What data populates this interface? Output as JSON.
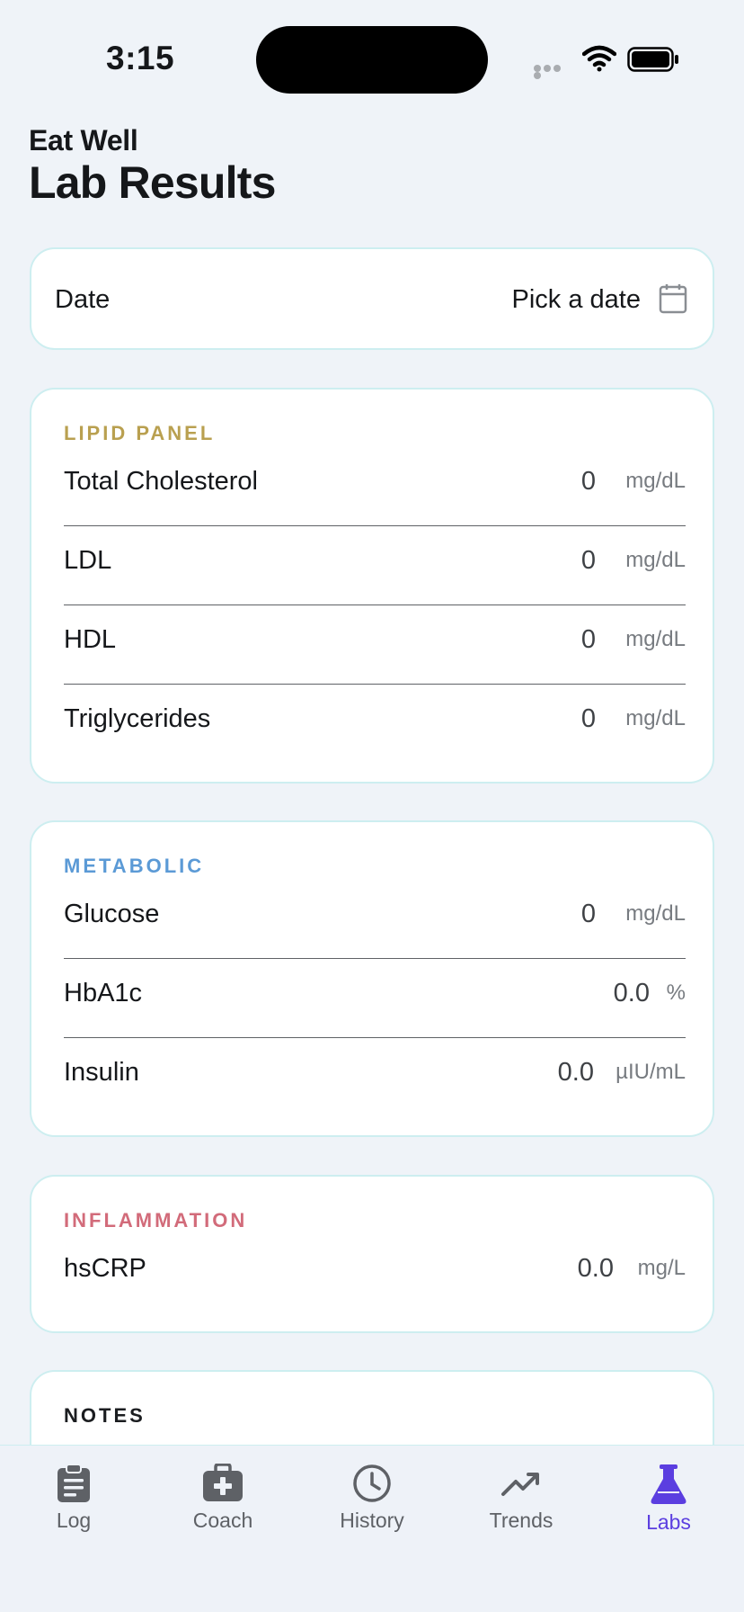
{
  "status_bar": {
    "time": "3:15"
  },
  "header": {
    "app_name": "Eat Well",
    "title": "Lab Results"
  },
  "date_field": {
    "label": "Date",
    "value": "Pick a date"
  },
  "sections": {
    "lipid": {
      "title": "LIPID PANEL",
      "color": "#b9a050",
      "rows": [
        {
          "label": "Total Cholesterol",
          "value": "0",
          "unit": "mg/dL"
        },
        {
          "label": "LDL",
          "value": "0",
          "unit": "mg/dL"
        },
        {
          "label": "HDL",
          "value": "0",
          "unit": "mg/dL"
        },
        {
          "label": "Triglycerides",
          "value": "0",
          "unit": "mg/dL"
        }
      ]
    },
    "metabolic": {
      "title": "METABOLIC",
      "color": "#5b9ad6",
      "rows": [
        {
          "label": "Glucose",
          "value": "0",
          "unit": "mg/dL"
        },
        {
          "label": "HbA1c",
          "value": "0.0",
          "unit": "%"
        },
        {
          "label": "Insulin",
          "value": "0.0",
          "unit": "µIU/mL"
        }
      ]
    },
    "inflammation": {
      "title": "INFLAMMATION",
      "color": "#d26b7a",
      "rows": [
        {
          "label": "hsCRP",
          "value": "0.0",
          "unit": "mg/L"
        }
      ]
    },
    "notes": {
      "title": "NOTES",
      "color": "#1b1d20"
    }
  },
  "tab_bar": {
    "active_color": "#5b3ee0",
    "tabs": [
      {
        "label": "Log",
        "icon": "clipboard-icon"
      },
      {
        "label": "Coach",
        "icon": "medkit-icon"
      },
      {
        "label": "History",
        "icon": "clock-icon"
      },
      {
        "label": "Trends",
        "icon": "trend-up-icon"
      },
      {
        "label": "Labs",
        "icon": "flask-icon",
        "active": true
      }
    ]
  }
}
